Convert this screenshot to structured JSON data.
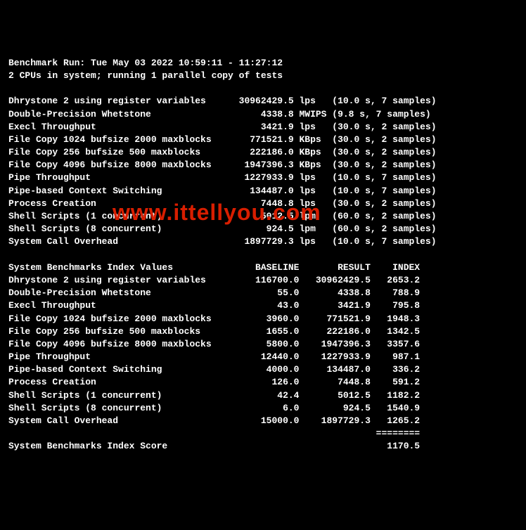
{
  "header": {
    "run_line": "Benchmark Run: Tue May 03 2022 10:59:11 - 11:27:12",
    "cpu_line": "2 CPUs in system; running 1 parallel copy of tests"
  },
  "results": [
    {
      "name": "Dhrystone 2 using register variables",
      "value": "30962429.5",
      "unit": "lps",
      "time": "10.0 s",
      "samples": "7 samples"
    },
    {
      "name": "Double-Precision Whetstone",
      "value": "4338.8",
      "unit": "MWIPS",
      "time": "9.8 s",
      "samples": "7 samples"
    },
    {
      "name": "Execl Throughput",
      "value": "3421.9",
      "unit": "lps",
      "time": "30.0 s",
      "samples": "2 samples"
    },
    {
      "name": "File Copy 1024 bufsize 2000 maxblocks",
      "value": "771521.9",
      "unit": "KBps",
      "time": "30.0 s",
      "samples": "2 samples"
    },
    {
      "name": "File Copy 256 bufsize 500 maxblocks",
      "value": "222186.0",
      "unit": "KBps",
      "time": "30.0 s",
      "samples": "2 samples"
    },
    {
      "name": "File Copy 4096 bufsize 8000 maxblocks",
      "value": "1947396.3",
      "unit": "KBps",
      "time": "30.0 s",
      "samples": "2 samples"
    },
    {
      "name": "Pipe Throughput",
      "value": "1227933.9",
      "unit": "lps",
      "time": "10.0 s",
      "samples": "7 samples"
    },
    {
      "name": "Pipe-based Context Switching",
      "value": "134487.0",
      "unit": "lps",
      "time": "10.0 s",
      "samples": "7 samples"
    },
    {
      "name": "Process Creation",
      "value": "7448.8",
      "unit": "lps",
      "time": "30.0 s",
      "samples": "2 samples"
    },
    {
      "name": "Shell Scripts (1 concurrent)",
      "value": "5012.5",
      "unit": "lpm",
      "time": "60.0 s",
      "samples": "2 samples"
    },
    {
      "name": "Shell Scripts (8 concurrent)",
      "value": "924.5",
      "unit": "lpm",
      "time": "60.0 s",
      "samples": "2 samples"
    },
    {
      "name": "System Call Overhead",
      "value": "1897729.3",
      "unit": "lps",
      "time": "10.0 s",
      "samples": "7 samples"
    }
  ],
  "index_header": {
    "title": "System Benchmarks Index Values",
    "col_baseline": "BASELINE",
    "col_result": "RESULT",
    "col_index": "INDEX"
  },
  "index_rows": [
    {
      "name": "Dhrystone 2 using register variables",
      "baseline": "116700.0",
      "result": "30962429.5",
      "index": "2653.2"
    },
    {
      "name": "Double-Precision Whetstone",
      "baseline": "55.0",
      "result": "4338.8",
      "index": "788.9"
    },
    {
      "name": "Execl Throughput",
      "baseline": "43.0",
      "result": "3421.9",
      "index": "795.8"
    },
    {
      "name": "File Copy 1024 bufsize 2000 maxblocks",
      "baseline": "3960.0",
      "result": "771521.9",
      "index": "1948.3"
    },
    {
      "name": "File Copy 256 bufsize 500 maxblocks",
      "baseline": "1655.0",
      "result": "222186.0",
      "index": "1342.5"
    },
    {
      "name": "File Copy 4096 bufsize 8000 maxblocks",
      "baseline": "5800.0",
      "result": "1947396.3",
      "index": "3357.6"
    },
    {
      "name": "Pipe Throughput",
      "baseline": "12440.0",
      "result": "1227933.9",
      "index": "987.1"
    },
    {
      "name": "Pipe-based Context Switching",
      "baseline": "4000.0",
      "result": "134487.0",
      "index": "336.2"
    },
    {
      "name": "Process Creation",
      "baseline": "126.0",
      "result": "7448.8",
      "index": "591.2"
    },
    {
      "name": "Shell Scripts (1 concurrent)",
      "baseline": "42.4",
      "result": "5012.5",
      "index": "1182.2"
    },
    {
      "name": "Shell Scripts (8 concurrent)",
      "baseline": "6.0",
      "result": "924.5",
      "index": "1540.9"
    },
    {
      "name": "System Call Overhead",
      "baseline": "15000.0",
      "result": "1897729.3",
      "index": "1265.2"
    }
  ],
  "divider": "========",
  "final": {
    "label": "System Benchmarks Index Score",
    "score": "1170.5"
  },
  "watermark": "www.ittellyou.com"
}
